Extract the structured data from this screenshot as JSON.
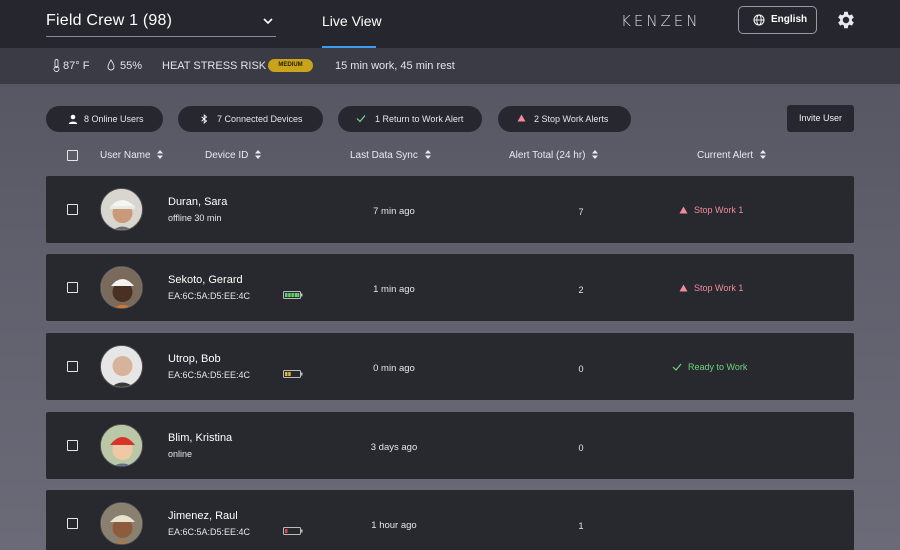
{
  "header": {
    "crew_select": "Field Crew 1 (98)",
    "tab_live": "Live View",
    "logo": "KENZEN",
    "language": "English"
  },
  "conditions": {
    "temperature": "87° F",
    "humidity": "55%",
    "heat_stress_label": "HEAT STRESS RISK",
    "heat_stress_level": "MEDIUM",
    "schedule": "15 min work, 45 min rest",
    "level_color": "#c9a319"
  },
  "filters": {
    "online_users": "8 Online Users",
    "connected_devices": "7 Connected Devices",
    "return_alert": "1 Return to Work Alert",
    "stop_alerts": "2 Stop Work Alerts",
    "invite": "Invite User"
  },
  "columns": {
    "user_name": "User Name",
    "device_id": "Device ID",
    "last_sync": "Last Data Sync",
    "alert_total": "Alert Total (24 hr)",
    "current_alert": "Current Alert"
  },
  "rows": [
    {
      "name": "Duran, Sara",
      "sub": "offline 30 min",
      "battery": "none",
      "sync": "7 min ago",
      "total": "7",
      "alert": "Stop Work 1",
      "alert_type": "stop"
    },
    {
      "name": "Sekoto, Gerard",
      "sub": "EA:6C:5A:D5:EE:4C",
      "battery": "full",
      "sync": "1 min ago",
      "total": "2",
      "alert": "Stop Work 1",
      "alert_type": "stop"
    },
    {
      "name": "Utrop, Bob",
      "sub": "EA:6C:5A:D5:EE:4C",
      "battery": "half",
      "sync": "0 min ago",
      "total": "0",
      "alert": "Ready to Work",
      "alert_type": "ready"
    },
    {
      "name": "Blim, Kristina",
      "sub": "online",
      "battery": "none",
      "sync": "3 days ago",
      "total": "0",
      "alert": "",
      "alert_type": "none"
    },
    {
      "name": "Jimenez, Raul",
      "sub": "EA:6C:5A:D5:EE:4C",
      "battery": "low",
      "sync": "1 hour ago",
      "total": "1",
      "alert": "",
      "alert_type": "none"
    }
  ],
  "colors": {
    "stop": "#f28a9b",
    "ready": "#6fd57b",
    "accent": "#3d9cf0"
  }
}
